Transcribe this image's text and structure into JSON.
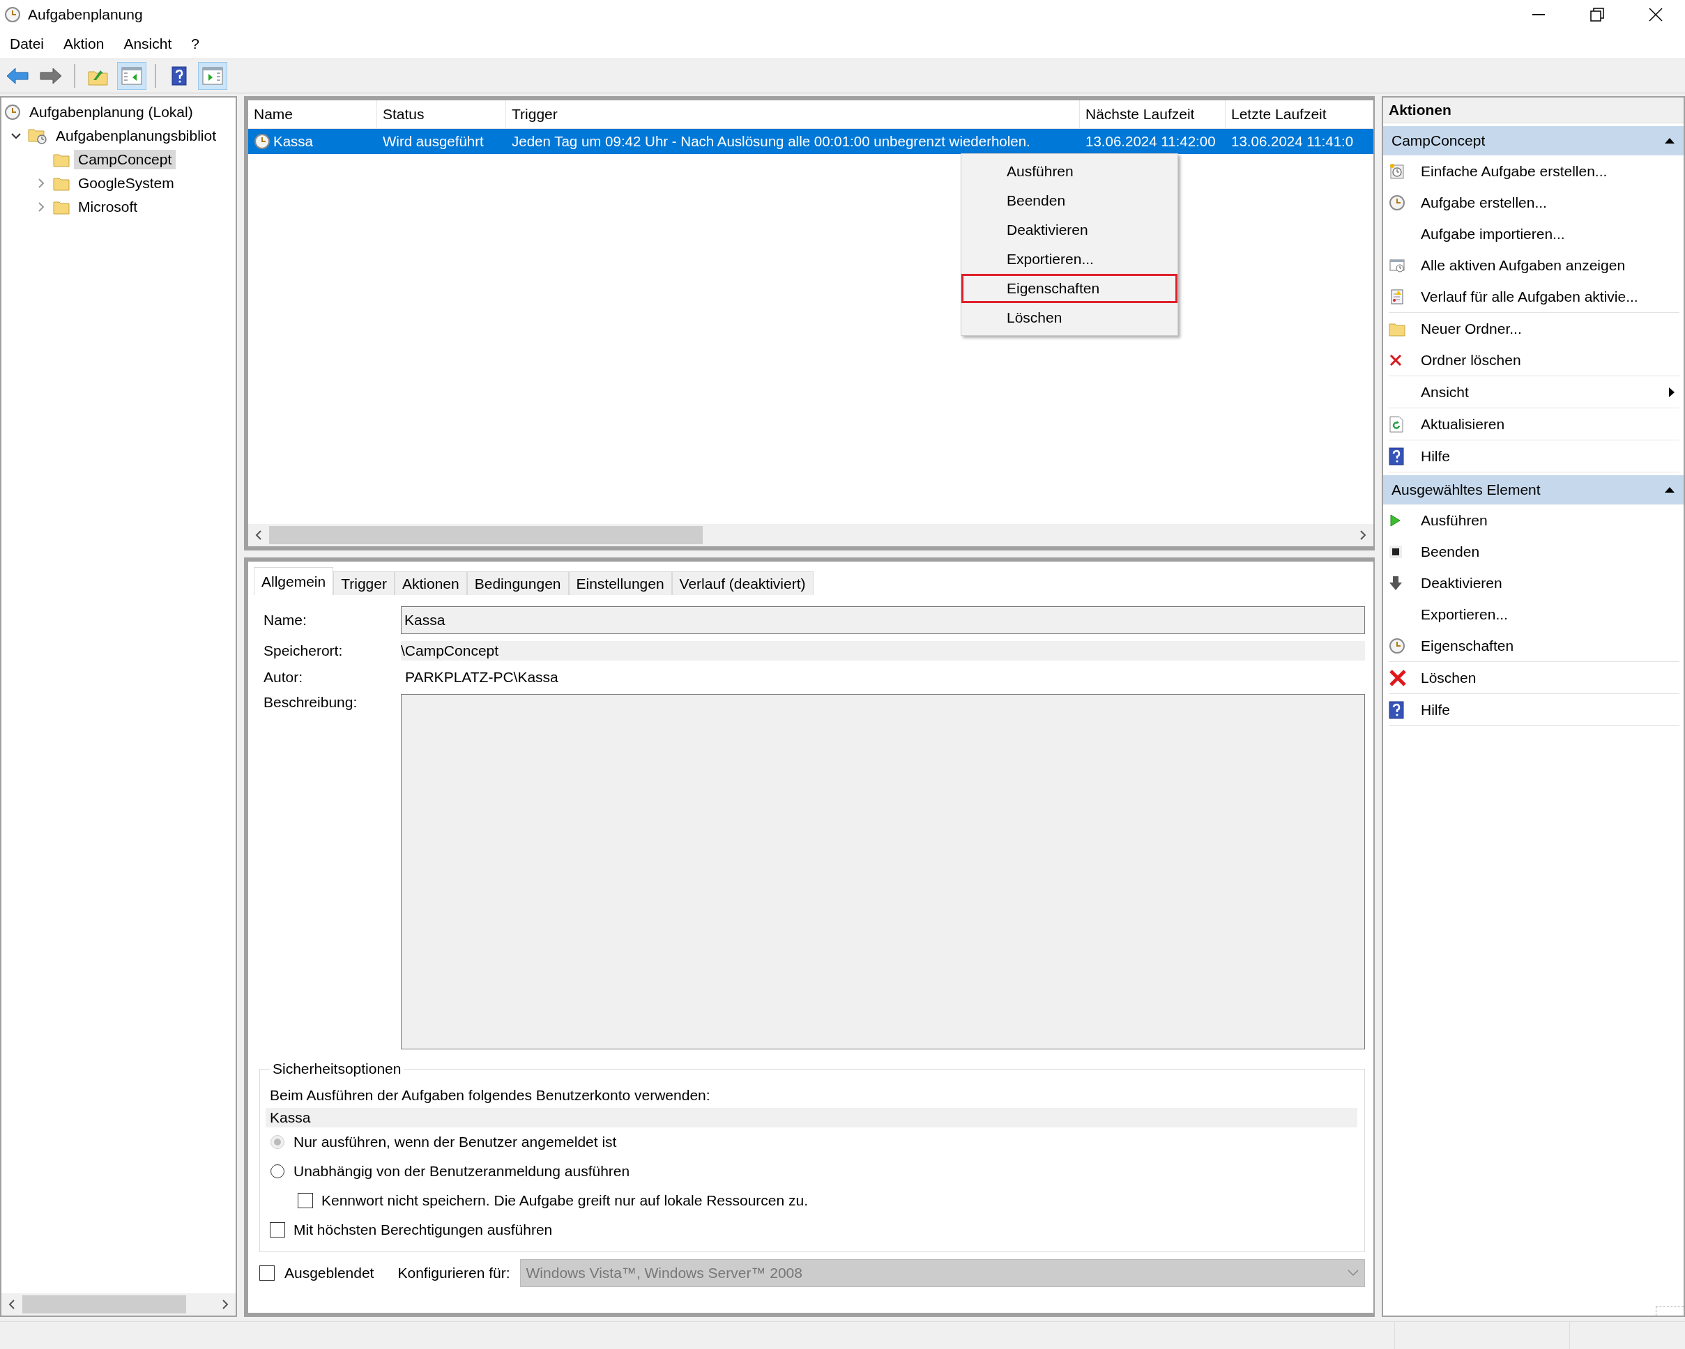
{
  "window": {
    "title": "Aufgabenplanung"
  },
  "menu": [
    "Datei",
    "Aktion",
    "Ansicht",
    "?"
  ],
  "toolbar": [
    [
      {
        "kind": "back",
        "on": false
      },
      {
        "kind": "forward",
        "on": false
      }
    ],
    [
      {
        "kind": "up-folder",
        "on": false
      },
      {
        "kind": "tree-pane",
        "on": true
      }
    ],
    [
      {
        "kind": "help",
        "on": false
      },
      {
        "kind": "action-pane",
        "on": true
      }
    ]
  ],
  "tree": [
    {
      "label": "Aufgabenplanung (Lokal)",
      "kind": "clock",
      "selected": false,
      "children": [
        {
          "label": "Aufgabenplanungsbibliot",
          "kind": "library",
          "selected": false,
          "expanded": true,
          "children": [
            {
              "label": "CampConcept",
              "kind": "folder",
              "selected": true
            },
            {
              "label": "GoogleSystem",
              "kind": "folder",
              "selected": false,
              "expanded": false
            },
            {
              "label": "Microsoft",
              "kind": "folder",
              "selected": false,
              "expanded": false
            }
          ]
        }
      ]
    }
  ],
  "task_list": {
    "columns": [
      "Name",
      "Status",
      "Trigger",
      "Nächste Laufzeit",
      "Letzte Laufzeit"
    ],
    "rows": [
      {
        "selected": true,
        "cells": [
          "Kassa",
          "Wird ausgeführt",
          "Jeden Tag um 09:42 Uhr - Nach Auslösung alle 00:01:00 unbegrenzt wiederholen.",
          "13.06.2024 11:42:00",
          "13.06.2024 11:41:0"
        ]
      }
    ]
  },
  "context_menu": {
    "items": [
      {
        "label": "Ausführen",
        "highlighted": false
      },
      {
        "label": "Beenden",
        "highlighted": false
      },
      {
        "label": "Deaktivieren",
        "highlighted": false
      },
      {
        "label": "Exportieren...",
        "highlighted": false
      },
      {
        "label": "Eigenschaften",
        "highlighted": true
      },
      {
        "label": "Löschen",
        "highlighted": false
      }
    ]
  },
  "detail_tabs": [
    {
      "label": "Allgemein",
      "selected": true
    },
    {
      "label": "Trigger",
      "selected": false
    },
    {
      "label": "Aktionen",
      "selected": false
    },
    {
      "label": "Bedingungen",
      "selected": false
    },
    {
      "label": "Einstellungen",
      "selected": false
    },
    {
      "label": "Verlauf (deaktiviert)",
      "selected": false
    }
  ],
  "general": {
    "name_label": "Name:",
    "name_value": "Kassa",
    "location_label": "Speicherort:",
    "location": "\\CampConcept",
    "author_label": "Autor:",
    "author": "PARKPLATZ-PC\\Kassa",
    "description_label": "Beschreibung:"
  },
  "security": {
    "title": "Sicherheitsoptionen",
    "account_prompt": "Beim Ausführen der Aufgaben folgendes Benutzerkonto verwenden:",
    "account": "Kassa",
    "options": [
      {
        "kind": "radio",
        "label": "Nur ausführen, wenn der Benutzer angemeldet ist",
        "checked": true,
        "disabled": true
      },
      {
        "kind": "radio",
        "label": "Unabhängig von der Benutzeranmeldung ausführen",
        "checked": false,
        "disabled": false,
        "children": [
          {
            "kind": "checkbox",
            "label": "Kennwort nicht speichern. Die Aufgabe greift nur auf lokale Ressourcen zu.",
            "checked": false,
            "disabled": false
          }
        ]
      },
      {
        "kind": "checkbox",
        "label": "Mit höchsten Berechtigungen ausführen",
        "checked": false,
        "disabled": false
      }
    ]
  },
  "hidden": {
    "label": "Ausgeblendet",
    "checked": false
  },
  "configure": {
    "label": "Konfigurieren für:",
    "value": "Windows Vista™, Windows Server™ 2008",
    "disabled": true
  },
  "actions_panel": {
    "title": "Aktionen",
    "sections": [
      {
        "title": "CampConcept",
        "expanded": true,
        "groups": [
          [
            {
              "label": "Einfache Aufgabe erstellen...",
              "kind": "clock-page"
            },
            {
              "label": "Aufgabe erstellen...",
              "kind": "clock"
            },
            {
              "label": "Aufgabe importieren...",
              "kind": "none"
            },
            {
              "label": "Alle aktiven Aufgaben anzeigen",
              "kind": "window-clock"
            },
            {
              "label": "Verlauf für alle Aufgaben aktivie...",
              "kind": "notebook"
            }
          ],
          [
            {
              "label": "Neuer Ordner...",
              "kind": "folder"
            },
            {
              "label": "Ordner löschen",
              "kind": "cross"
            }
          ],
          [
            {
              "label": "Ansicht",
              "kind": "none",
              "submenu": true
            }
          ],
          [
            {
              "label": "Aktualisieren",
              "kind": "refresh"
            }
          ],
          [
            {
              "label": "Hilfe",
              "kind": "help"
            }
          ]
        ]
      },
      {
        "title": "Ausgewähltes Element",
        "expanded": true,
        "groups": [
          [
            {
              "label": "Ausführen",
              "kind": "play"
            },
            {
              "label": "Beenden",
              "kind": "stop"
            },
            {
              "label": "Deaktivieren",
              "kind": "down-arrow"
            },
            {
              "label": "Exportieren...",
              "kind": "none"
            },
            {
              "label": "Eigenschaften",
              "kind": "clock"
            }
          ],
          [
            {
              "label": "Löschen",
              "kind": "cross-large"
            }
          ],
          [
            {
              "label": "Hilfe",
              "kind": "help"
            }
          ]
        ]
      }
    ]
  }
}
